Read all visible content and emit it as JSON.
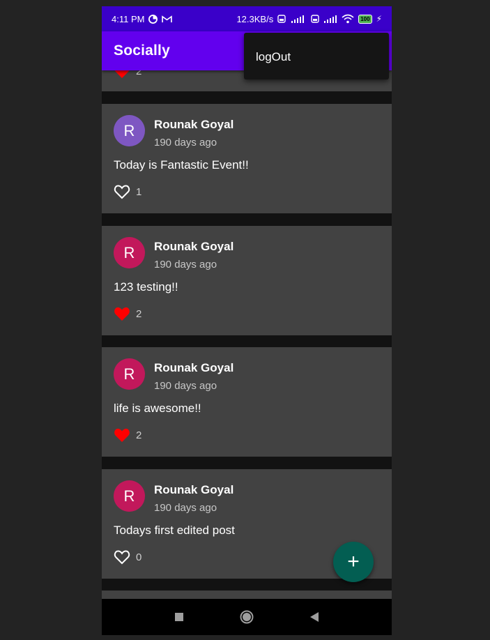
{
  "status_bar": {
    "time": "4:11 PM",
    "network_speed": "12.3KB/s",
    "battery": "100"
  },
  "app_bar": {
    "title": "Socially"
  },
  "overflow_menu": {
    "items": [
      {
        "label": "logOut"
      }
    ]
  },
  "partial_top_post": {
    "likes": "2",
    "liked": true
  },
  "posts": [
    {
      "initial": "R",
      "avatar_color": "#7e57c2",
      "author": "Rounak Goyal",
      "time": "190 days ago",
      "text": "Today is Fantastic Event!!",
      "likes": "1",
      "liked": false
    },
    {
      "initial": "R",
      "avatar_color": "#c2185b",
      "author": "Rounak Goyal",
      "time": "190 days ago",
      "text": "123 testing!!",
      "likes": "2",
      "liked": true
    },
    {
      "initial": "R",
      "avatar_color": "#c2185b",
      "author": "Rounak Goyal",
      "time": "190 days ago",
      "text": "life is awesome!!",
      "likes": "2",
      "liked": true
    },
    {
      "initial": "R",
      "avatar_color": "#c2185b",
      "author": "Rounak Goyal",
      "time": "190 days ago",
      "text": "Todays first edited post",
      "likes": "0",
      "liked": false
    }
  ],
  "fab": {
    "icon": "plus-icon",
    "symbol": "+"
  },
  "colors": {
    "status_bar": "#3a00c9",
    "app_bar": "#6200ee",
    "card": "#424242",
    "fab": "#035e52",
    "liked_heart": "#ff0000"
  }
}
